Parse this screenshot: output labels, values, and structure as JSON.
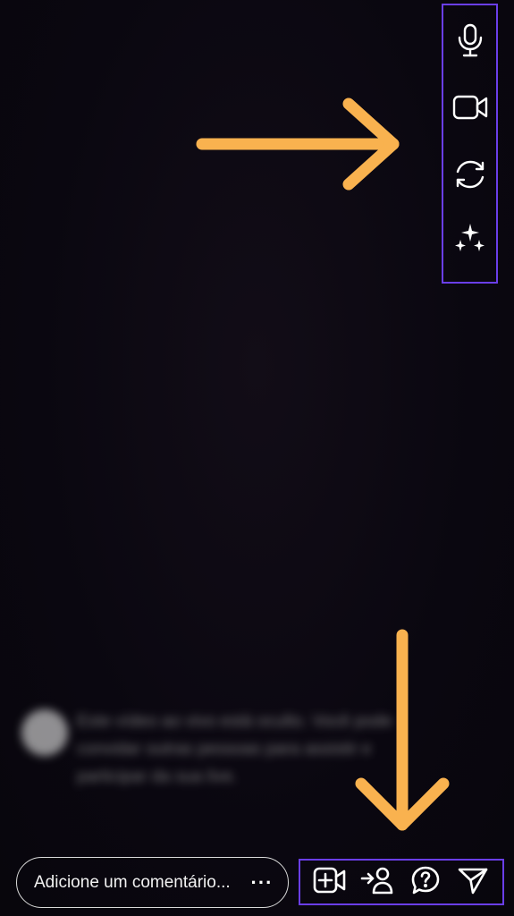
{
  "side_controls": {
    "icons": [
      "microphone-icon",
      "video-camera-icon",
      "flip-camera-icon",
      "effects-sparkle-icon"
    ]
  },
  "notice": {
    "text": "Este vídeo ao vivo está oculto. Você pode convidar outras pessoas para assistir e participar da sua live."
  },
  "comment": {
    "placeholder": "Adicione um comentário...",
    "more_label": "···"
  },
  "action_bar": {
    "icons": [
      "add-video-icon",
      "invite-guest-icon",
      "question-icon",
      "send-icon"
    ]
  },
  "colors": {
    "background": "#0b0810",
    "highlight_border": "#6a3ee8",
    "arrow": "#f9b24f",
    "icon": "#ffffff"
  }
}
